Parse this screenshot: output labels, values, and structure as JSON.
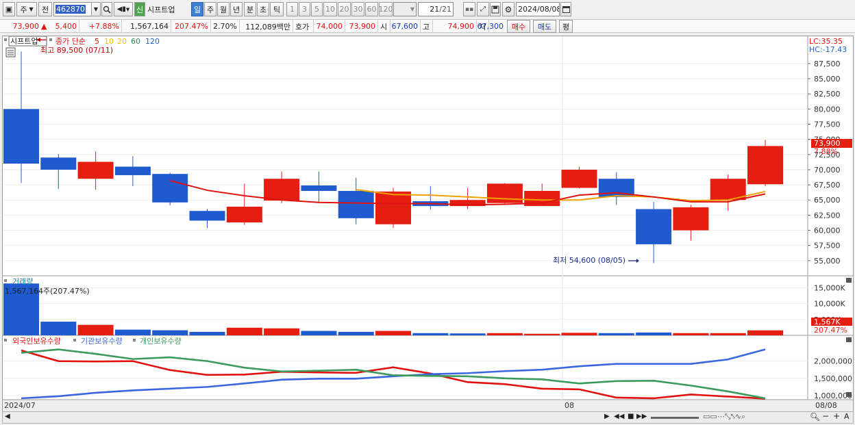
{
  "toolbar": {
    "period_unit": "주",
    "prev_label": "전",
    "code_value": "462870",
    "stock_name_badge": "신",
    "stock_name": "시프트업",
    "periods": [
      "일",
      "주",
      "월",
      "년",
      "분",
      "초",
      "틱"
    ],
    "active_period": "일",
    "minute_options": [
      "1",
      "3",
      "5",
      "10",
      "20",
      "30",
      "60",
      "120"
    ],
    "counter": "21",
    "counter_total": "/21",
    "date": "2024/08/08"
  },
  "quote": {
    "price": "73,900",
    "arrow": "▲",
    "change": "5,400",
    "change_pct": "+7.88%",
    "volume": "1,567,164",
    "volume_ratio": "207.47%",
    "turnover": "2.70%",
    "amount": "112,089백만",
    "bid_label": "호가",
    "ask": "74,000",
    "bid": "73,900",
    "open_label": "시",
    "open": "67,600",
    "high_label": "고",
    "high": "74,900",
    "low_label": "저",
    "low": "67,300",
    "buy_button": "매수",
    "sell_button": "매도",
    "avg_button": "평"
  },
  "legend": {
    "name": "시프트업",
    "ma_title": "종가 단순",
    "ma_periods": [
      "5",
      "10",
      "20",
      "60",
      "120"
    ],
    "ma_colors": [
      "#e0110f",
      "#f2c200",
      "#f2c200",
      "#2e8b57",
      "#1e5fd0"
    ]
  },
  "colors": {
    "up": "#e41f12",
    "down": "#1f5bce",
    "ma5": "#e0110f",
    "ma10": "#f0a000",
    "foreign": "#e0110f",
    "inst": "#3a66e0",
    "indiv": "#3c9a5c"
  },
  "annotations": {
    "high_note": "최고 89,500 (07/11)",
    "low_note": "최저 54,600 (08/05)",
    "lc": "LC:35.35",
    "hc": "HC:-17.43",
    "last_price": "73,900",
    "last_pct": "7.88%",
    "vol_last": "1,567K",
    "vol_pct": "207.47%"
  },
  "volume_panel": {
    "title": "거래량",
    "info": "1,567,164주(207.47%)"
  },
  "holdings_panel": {
    "series_names": [
      "외국인보유수량",
      "기관보유수량",
      "개인보유수량"
    ]
  },
  "x_labels": {
    "start": "2024/07",
    "mid": "08",
    "end": "08/08"
  },
  "chart_data": [
    {
      "type": "candlestick",
      "title": "시프트업",
      "ylim": [
        52500,
        92000
      ],
      "yticks": [
        "87,500",
        "85,000",
        "82,500",
        "80,000",
        "77,500",
        "75,000",
        "72,500",
        "70,000",
        "67,500",
        "65,000",
        "62,500",
        "60,000",
        "57,500",
        "55,000"
      ],
      "candles": [
        {
          "o": 80000,
          "h": 89500,
          "l": 67800,
          "c": 71000
        },
        {
          "o": 72000,
          "h": 72600,
          "l": 66800,
          "c": 70000
        },
        {
          "o": 68500,
          "h": 73000,
          "l": 66700,
          "c": 71300
        },
        {
          "o": 70500,
          "h": 72200,
          "l": 67300,
          "c": 69100
        },
        {
          "o": 69300,
          "h": 69500,
          "l": 64100,
          "c": 64600
        },
        {
          "o": 63200,
          "h": 63500,
          "l": 60400,
          "c": 61600
        },
        {
          "o": 61300,
          "h": 67700,
          "l": 60900,
          "c": 63900
        },
        {
          "o": 64900,
          "h": 69700,
          "l": 64500,
          "c": 68500
        },
        {
          "o": 67400,
          "h": 69700,
          "l": 64500,
          "c": 66500
        },
        {
          "o": 66500,
          "h": 68700,
          "l": 61000,
          "c": 62000
        },
        {
          "o": 61000,
          "h": 67000,
          "l": 60400,
          "c": 66400
        },
        {
          "o": 64800,
          "h": 67300,
          "l": 63400,
          "c": 64000
        },
        {
          "o": 64000,
          "h": 67000,
          "l": 63500,
          "c": 65000
        },
        {
          "o": 64500,
          "h": 67800,
          "l": 64300,
          "c": 67700
        },
        {
          "o": 64000,
          "h": 67700,
          "l": 64000,
          "c": 66500
        },
        {
          "o": 67000,
          "h": 70500,
          "l": 66900,
          "c": 70000
        },
        {
          "o": 68500,
          "h": 69600,
          "l": 64200,
          "c": 65500
        },
        {
          "o": 63500,
          "h": 64700,
          "l": 54600,
          "c": 57700
        },
        {
          "o": 60000,
          "h": 64200,
          "l": 58300,
          "c": 63800
        },
        {
          "o": 65000,
          "h": 69200,
          "l": 63200,
          "c": 68500
        },
        {
          "o": 67600,
          "h": 74900,
          "l": 67300,
          "c": 73900
        }
      ],
      "ma5": [
        null,
        null,
        null,
        null,
        68200,
        66600,
        65700,
        65000,
        64600,
        64500,
        64400,
        64400,
        64200,
        64300,
        64500,
        65800,
        66200,
        65500,
        64700,
        64700,
        66000
      ],
      "ma10": [
        null,
        null,
        null,
        null,
        null,
        null,
        null,
        null,
        null,
        66700,
        65900,
        65800,
        65500,
        65200,
        65000,
        65000,
        65700,
        65500,
        64900,
        65000,
        66400
      ]
    },
    {
      "type": "bar",
      "title": "거래량",
      "yticks": [
        "15,000K",
        "10,000K",
        "5,000K"
      ],
      "ylim": [
        0,
        17000000
      ],
      "values": [
        16300000,
        4300000,
        3300000,
        1800000,
        1600000,
        1100000,
        2400000,
        2200000,
        1400000,
        1100000,
        1400000,
        700000,
        600000,
        700000,
        500000,
        800000,
        700000,
        900000,
        700000,
        700000,
        1567164
      ],
      "up": [
        false,
        false,
        true,
        false,
        false,
        false,
        true,
        true,
        false,
        false,
        true,
        false,
        false,
        true,
        true,
        true,
        false,
        false,
        true,
        true,
        true
      ]
    },
    {
      "type": "line",
      "title": "보유수량",
      "yticks": [
        "2,000,000",
        "1,500,000",
        "1,000,000"
      ],
      "ylim": [
        880000,
        2450000
      ],
      "series": [
        {
          "name": "외국인보유수량",
          "values": [
            2310000,
            2000000,
            1990000,
            2000000,
            1740000,
            1600000,
            1610000,
            1690000,
            1670000,
            1660000,
            1820000,
            1640000,
            1390000,
            1330000,
            1200000,
            1180000,
            940000,
            920000,
            1030000,
            970000,
            910000
          ]
        },
        {
          "name": "기관보유수량",
          "values": [
            920000,
            980000,
            1080000,
            1150000,
            1200000,
            1250000,
            1350000,
            1460000,
            1490000,
            1490000,
            1560000,
            1620000,
            1650000,
            1710000,
            1750000,
            1850000,
            1920000,
            1920000,
            1920000,
            2050000,
            2340000
          ]
        },
        {
          "name": "개인보유수량",
          "values": [
            2240000,
            2340000,
            2210000,
            2060000,
            2110000,
            2000000,
            1810000,
            1700000,
            1720000,
            1750000,
            1590000,
            1570000,
            1560000,
            1500000,
            1470000,
            1350000,
            1420000,
            1430000,
            1290000,
            1120000,
            920000
          ]
        }
      ]
    }
  ]
}
